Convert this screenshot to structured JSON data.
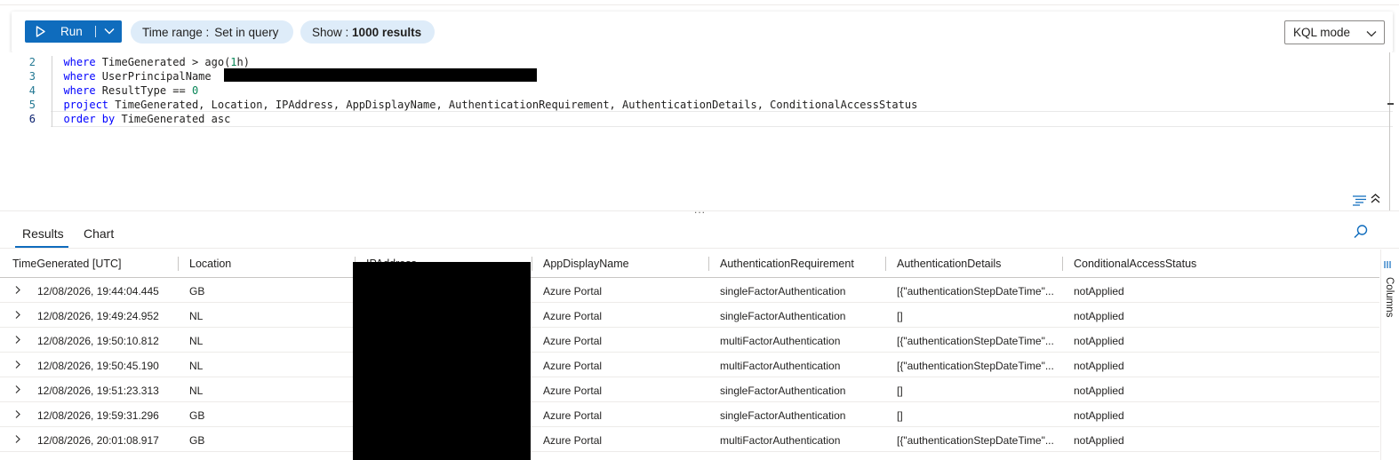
{
  "toolbar": {
    "run_label": "Run",
    "time_range_label": "Time range :",
    "time_range_value": "Set in query",
    "show_label": "Show :",
    "show_value": "1000 results",
    "mode_select": "KQL mode"
  },
  "editor": {
    "line_numbers": [
      "2",
      "3",
      "4",
      "5",
      "6"
    ],
    "lines": {
      "l2": {
        "kw": "where",
        "text": " TimeGenerated > ago(",
        "num": "1",
        "tail": "h)"
      },
      "l3": {
        "kw": "where",
        "text": " UserPrincipalName "
      },
      "l4": {
        "kw": "where",
        "text": " ResultType == ",
        "num": "0"
      },
      "l5": {
        "kw": "project",
        "text": " TimeGenerated, Location, IPAddress, AppDisplayName, AuthenticationRequirement, AuthenticationDetails, ConditionalAccessStatus"
      },
      "l6": {
        "kw": "order by",
        "text": " TimeGenerated asc"
      }
    },
    "splitter_dots": "..."
  },
  "results": {
    "tabs": [
      "Results",
      "Chart"
    ],
    "columns_label": "Columns",
    "headers": [
      "TimeGenerated [UTC]",
      "Location",
      "IPAddress",
      "AppDisplayName",
      "AuthenticationRequirement",
      "AuthenticationDetails",
      "ConditionalAccessStatus"
    ],
    "rows": [
      {
        "time": "12/08/2026, 19:44:04.445",
        "location": "GB",
        "app": "Azure Portal",
        "req": "singleFactorAuthentication",
        "details": "[{\"authenticationStepDateTime\"...",
        "status": "notApplied"
      },
      {
        "time": "12/08/2026, 19:49:24.952",
        "location": "NL",
        "app": "Azure Portal",
        "req": "singleFactorAuthentication",
        "details": "[]",
        "status": "notApplied"
      },
      {
        "time": "12/08/2026, 19:50:10.812",
        "location": "NL",
        "app": "Azure Portal",
        "req": "multiFactorAuthentication",
        "details": "[{\"authenticationStepDateTime\"...",
        "status": "notApplied"
      },
      {
        "time": "12/08/2026, 19:50:45.190",
        "location": "NL",
        "app": "Azure Portal",
        "req": "multiFactorAuthentication",
        "details": "[{\"authenticationStepDateTime\"...",
        "status": "notApplied"
      },
      {
        "time": "12/08/2026, 19:51:23.313",
        "location": "NL",
        "app": "Azure Portal",
        "req": "singleFactorAuthentication",
        "details": "[]",
        "status": "notApplied"
      },
      {
        "time": "12/08/2026, 19:59:31.296",
        "location": "GB",
        "app": "Azure Portal",
        "req": "singleFactorAuthentication",
        "details": "[]",
        "status": "notApplied"
      },
      {
        "time": "12/08/2026, 20:01:08.917",
        "location": "GB",
        "app": "Azure Portal",
        "req": "multiFactorAuthentication",
        "details": "[{\"authenticationStepDateTime\"...",
        "status": "notApplied"
      }
    ]
  },
  "colors": {
    "accent": "#0f6cbd",
    "pill_bg": "#deecf9",
    "keyword": "#0000ff",
    "number": "#098658",
    "line_number": "#237893"
  }
}
